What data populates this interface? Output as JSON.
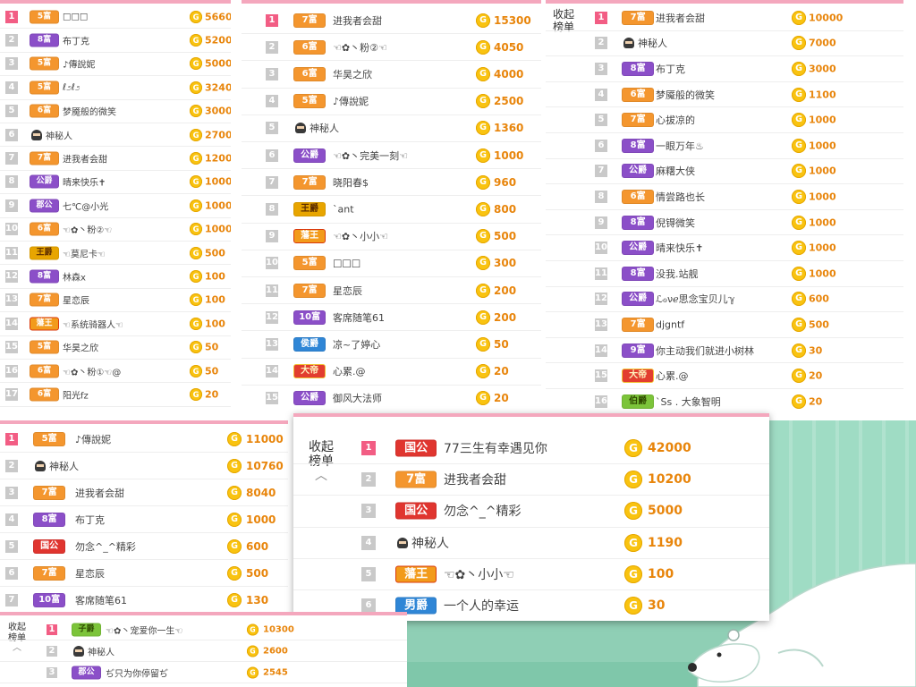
{
  "collapse_label": "收起榜单",
  "chevron": "︿",
  "coin_glyph": "G",
  "icons": {
    "ninja": "ninja-avatar-icon",
    "coin": "gold-coin-icon"
  },
  "colors": {
    "rank_first": "#f25d84",
    "rank_other": "#c9c9c9",
    "value": "#e8850b",
    "coin": "#f9c310",
    "topbar": "#f4a7bd"
  },
  "panels": {
    "p1": {
      "rows": [
        {
          "rank": "1",
          "badge": "5富",
          "name": "□□□",
          "value": "5660"
        },
        {
          "rank": "2",
          "badge": "8富",
          "name": "布丁克",
          "value": "5200"
        },
        {
          "rank": "3",
          "badge": "5富",
          "name": "♪傳說妮",
          "value": "5000"
        },
        {
          "rank": "4",
          "badge": "5富",
          "name": "ℓ೨ℓ೨",
          "value": "3240"
        },
        {
          "rank": "5",
          "badge": "6富",
          "name": "梦魇般的微笑",
          "value": "3000"
        },
        {
          "rank": "6",
          "badge": "",
          "name": "神秘人",
          "value": "2700"
        },
        {
          "rank": "7",
          "badge": "7富",
          "name": "进我者会甜",
          "value": "1200"
        },
        {
          "rank": "8",
          "badge": "公爵",
          "name": "晴来快乐✝",
          "value": "1000"
        },
        {
          "rank": "9",
          "badge": "郡公",
          "name": "七℃@小光",
          "value": "1000"
        },
        {
          "rank": "10",
          "badge": "6富",
          "name": "☜✿丶粉②☜",
          "value": "1000"
        },
        {
          "rank": "11",
          "badge": "王爵",
          "name": "☜莫尼卡☜",
          "value": "500"
        },
        {
          "rank": "12",
          "badge": "8富",
          "name": "林森x",
          "value": "100"
        },
        {
          "rank": "13",
          "badge": "7富",
          "name": "星恋辰",
          "value": "100"
        },
        {
          "rank": "14",
          "badge": "藩王",
          "name": "☜系统骑器人☜",
          "value": "100"
        },
        {
          "rank": "15",
          "badge": "5富",
          "name": "华昊之欣",
          "value": "50"
        },
        {
          "rank": "16",
          "badge": "6富",
          "name": "☜✿丶粉①☜@",
          "value": "50"
        },
        {
          "rank": "17",
          "badge": "6富",
          "name": "阳光fz",
          "value": "20"
        }
      ]
    },
    "p2": {
      "rows": [
        {
          "rank": "1",
          "badge": "7富",
          "name": "进我者会甜",
          "value": "15300"
        },
        {
          "rank": "2",
          "badge": "6富",
          "name": "☜✿丶粉②☜",
          "value": "4050"
        },
        {
          "rank": "3",
          "badge": "6富",
          "name": "华昊之欣",
          "value": "4000"
        },
        {
          "rank": "4",
          "badge": "5富",
          "name": "♪傳說妮",
          "value": "2500"
        },
        {
          "rank": "5",
          "badge": "",
          "name": "神秘人",
          "value": "1360"
        },
        {
          "rank": "6",
          "badge": "公爵",
          "name": "☜✿丶完美一刻☜",
          "value": "1000"
        },
        {
          "rank": "7",
          "badge": "7富",
          "name": "晓阳春$",
          "value": "960"
        },
        {
          "rank": "8",
          "badge": "王爵",
          "name": "`ant",
          "value": "800"
        },
        {
          "rank": "9",
          "badge": "藩王",
          "name": "☜✿丶小小☜",
          "value": "500"
        },
        {
          "rank": "10",
          "badge": "5富",
          "name": "□□□",
          "value": "300"
        },
        {
          "rank": "11",
          "badge": "7富",
          "name": "星恋辰",
          "value": "200"
        },
        {
          "rank": "12",
          "badge": "10富",
          "name": "客席随笔61",
          "value": "200"
        },
        {
          "rank": "13",
          "badge": "侯爵",
          "name": "凉~了婷心",
          "value": "50"
        },
        {
          "rank": "14",
          "badge": "大帝",
          "name": "心累.@",
          "value": "20"
        },
        {
          "rank": "15",
          "badge": "公爵",
          "name": "御风大法师",
          "value": "20"
        }
      ]
    },
    "p3": {
      "rows": [
        {
          "rank": "1",
          "badge": "7富",
          "name": "进我者会甜",
          "value": "10000"
        },
        {
          "rank": "2",
          "badge": "",
          "name": "神秘人",
          "value": "7000"
        },
        {
          "rank": "3",
          "badge": "8富",
          "name": "布丁克",
          "value": "3000"
        },
        {
          "rank": "4",
          "badge": "6富",
          "name": "梦魇般的微笑",
          "value": "1100"
        },
        {
          "rank": "5",
          "badge": "7富",
          "name": "心拔凉的",
          "value": "1000"
        },
        {
          "rank": "6",
          "badge": "8富",
          "name": "一眼万年♨",
          "value": "1000"
        },
        {
          "rank": "7",
          "badge": "公爵",
          "name": "麻糬大侠",
          "value": "1000"
        },
        {
          "rank": "8",
          "badge": "6富",
          "name": "情尝路也长",
          "value": "1000"
        },
        {
          "rank": "9",
          "badge": "8富",
          "name": "倪锝微笑",
          "value": "1000"
        },
        {
          "rank": "10",
          "badge": "公爵",
          "name": "晴来快乐✝",
          "value": "1000"
        },
        {
          "rank": "11",
          "badge": "8富",
          "name": "没我.站舰",
          "value": "1000"
        },
        {
          "rank": "12",
          "badge": "公爵",
          "name": "ℒℴνℯ思念宝贝儿ℽ",
          "value": "600"
        },
        {
          "rank": "13",
          "badge": "7富",
          "name": "djgntf",
          "value": "500"
        },
        {
          "rank": "14",
          "badge": "9富",
          "name": "你主动我们就进小树林",
          "value": "30"
        },
        {
          "rank": "15",
          "badge": "大帝",
          "name": "心累.@",
          "value": "20"
        },
        {
          "rank": "16",
          "badge": "伯爵",
          "name": "ˋSs . 大象智明",
          "value": "20"
        }
      ]
    },
    "p4": {
      "rows": [
        {
          "rank": "1",
          "badge": "5富",
          "name": "♪傳說妮",
          "value": "11000"
        },
        {
          "rank": "2",
          "badge": "",
          "name": "神秘人",
          "value": "10760"
        },
        {
          "rank": "3",
          "badge": "7富",
          "name": "进我者会甜",
          "value": "8040"
        },
        {
          "rank": "4",
          "badge": "8富",
          "name": "布丁克",
          "value": "1000"
        },
        {
          "rank": "5",
          "badge": "国公",
          "name": "勿念^_^精彩",
          "value": "600"
        },
        {
          "rank": "6",
          "badge": "7富",
          "name": "星恋辰",
          "value": "500"
        },
        {
          "rank": "7",
          "badge": "10富",
          "name": "客席随笔61",
          "value": "130"
        }
      ]
    },
    "p5": {
      "rows": [
        {
          "rank": "1",
          "badge": "国公",
          "name": "77三生有幸遇见你",
          "value": "42000"
        },
        {
          "rank": "2",
          "badge": "7富",
          "name": "进我者会甜",
          "value": "10200"
        },
        {
          "rank": "3",
          "badge": "国公",
          "name": "勿念^_^精彩",
          "value": "5000"
        },
        {
          "rank": "4",
          "badge": "",
          "name": "神秘人",
          "value": "1190"
        },
        {
          "rank": "5",
          "badge": "藩王",
          "name": "☜✿丶小小☜",
          "value": "100"
        },
        {
          "rank": "6",
          "badge": "男爵",
          "name": "一个人的幸运",
          "value": "30"
        }
      ]
    },
    "p6": {
      "rows": [
        {
          "rank": "1",
          "badge": "子爵",
          "name": "☜✿丶宠爱你一生☜",
          "value": "10300"
        },
        {
          "rank": "2",
          "badge": "",
          "name": "神秘人",
          "value": "2600"
        },
        {
          "rank": "3",
          "badge": "郡公",
          "name": "ぢ只为你停留ぢ",
          "value": "2545"
        }
      ]
    }
  }
}
